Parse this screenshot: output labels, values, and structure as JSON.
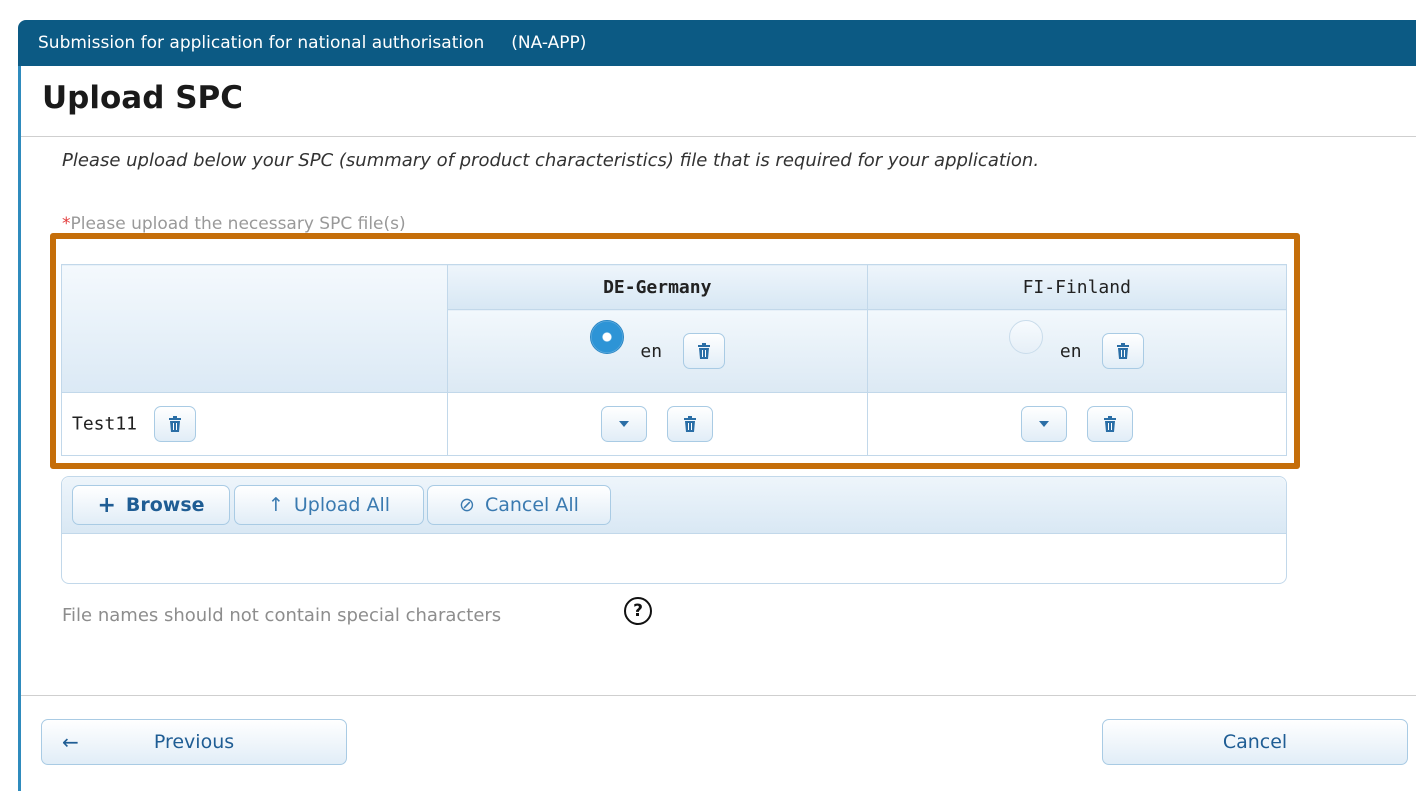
{
  "header": {
    "title": "Submission for application for national authorisation     (NA-APP)"
  },
  "page": {
    "title": "Upload SPC",
    "intro": "Please upload below your SPC (summary of product characteristics) file that is required for your application.",
    "required_mark": "*",
    "required_label": "Please upload the necessary SPC file(s)"
  },
  "table": {
    "countries": [
      {
        "name": "DE-Germany",
        "bold": true,
        "language": "en",
        "selected": true
      },
      {
        "name": "FI-Finland",
        "bold": false,
        "language": "en",
        "selected": false
      }
    ],
    "rows": [
      {
        "file": "Test11"
      }
    ]
  },
  "uploader": {
    "browse_icon": "+",
    "browse_label": "Browse",
    "upload_icon": "↑",
    "upload_all_label": "Upload All",
    "cancel_icon": "⊘",
    "cancel_all_label": "Cancel All"
  },
  "note": {
    "text": "File names should not contain special characters",
    "help_glyph": "?"
  },
  "footer": {
    "previous_arrow": "←",
    "previous_label": "Previous",
    "cancel_label": "Cancel"
  },
  "colors": {
    "header_bg": "#0c5a84",
    "highlight": "#c56e0a",
    "accent": "#2d94d6"
  }
}
